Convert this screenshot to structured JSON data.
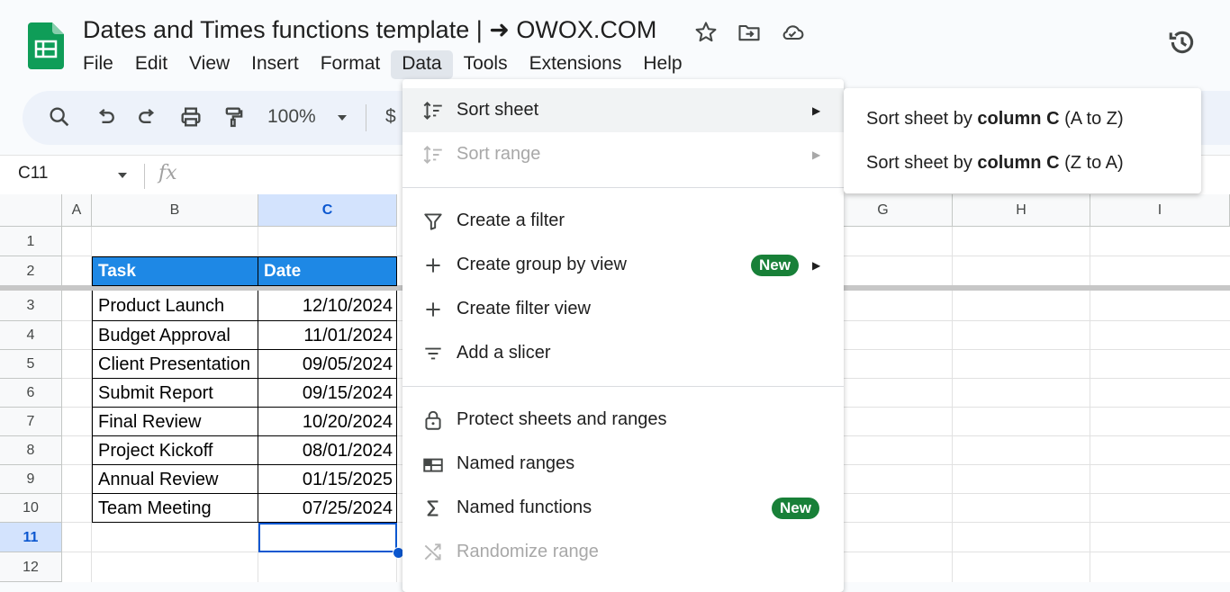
{
  "header": {
    "title": "Dates and Times functions template | ➜ OWOX.COM",
    "menu": [
      "File",
      "Edit",
      "View",
      "Insert",
      "Format",
      "Data",
      "Tools",
      "Extensions",
      "Help"
    ],
    "active_menu": "Data"
  },
  "toolbar": {
    "zoom": "100%",
    "currency": "$"
  },
  "formula_bar": {
    "name_box": "C11",
    "fx": "fx"
  },
  "grid": {
    "columns": [
      "A",
      "B",
      "C",
      "G",
      "H",
      "I"
    ],
    "rows": [
      "1",
      "2",
      "3",
      "4",
      "5",
      "6",
      "7",
      "8",
      "9",
      "10",
      "11",
      "12"
    ],
    "selected_column": "C",
    "selected_row": "11",
    "header": {
      "task": "Task",
      "date": "Date"
    },
    "data": [
      {
        "task": "Product Launch",
        "date": "12/10/2024"
      },
      {
        "task": "Budget Approval",
        "date": "11/01/2024"
      },
      {
        "task": "Client Presentation",
        "date": "09/05/2024"
      },
      {
        "task": "Submit Report",
        "date": "09/15/2024"
      },
      {
        "task": "Final Review",
        "date": "10/20/2024"
      },
      {
        "task": "Project Kickoff",
        "date": "08/01/2024"
      },
      {
        "task": "Annual Review",
        "date": "01/15/2025"
      },
      {
        "task": "Team Meeting",
        "date": "07/25/2024"
      }
    ]
  },
  "data_menu": {
    "items": [
      {
        "label": "Sort sheet",
        "icon": "sort-icon"
      },
      {
        "label": "Sort range",
        "icon": "sort-icon"
      },
      {
        "label": "Create a filter",
        "icon": "filter-icon"
      },
      {
        "label": "Create group by view",
        "icon": "plus-icon",
        "badge": "New"
      },
      {
        "label": "Create filter view",
        "icon": "plus-icon"
      },
      {
        "label": "Add a slicer",
        "icon": "slicer-icon"
      },
      {
        "label": "Protect sheets and ranges",
        "icon": "lock-icon"
      },
      {
        "label": "Named ranges",
        "icon": "named-ranges-icon"
      },
      {
        "label": "Named functions",
        "icon": "sigma-icon",
        "badge": "New"
      },
      {
        "label": "Randomize range",
        "icon": "shuffle-icon"
      }
    ]
  },
  "submenu": {
    "items": [
      {
        "prefix": "Sort sheet by ",
        "bold": "column C",
        "suffix": " (A to Z)"
      },
      {
        "prefix": "Sort sheet by ",
        "bold": "column C",
        "suffix": " (Z to A)"
      }
    ]
  },
  "colors": {
    "header_fill": "#1e88e5",
    "selection": "#0b57d0",
    "new_badge": "#188038",
    "sheets_green": "#0f9d58"
  }
}
